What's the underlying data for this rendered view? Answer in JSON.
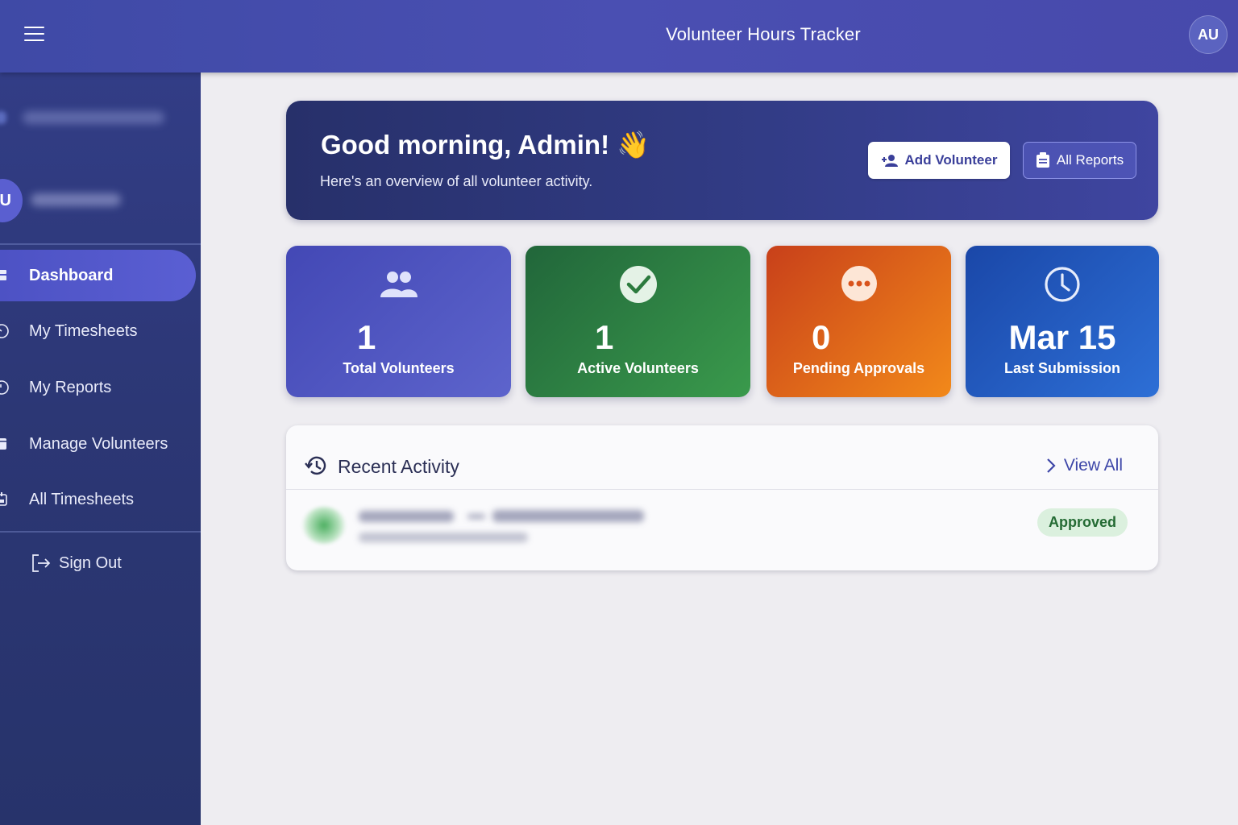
{
  "app": {
    "title": "Volunteer Hours Tracker",
    "user_initials": "AU"
  },
  "sidebar": {
    "user_initial": "U",
    "items": [
      {
        "label": "Dashboard",
        "icon": "dashboard-icon",
        "active": true
      },
      {
        "label": "My Timesheets",
        "icon": "clock-icon",
        "active": false
      },
      {
        "label": "My Reports",
        "icon": "report-icon",
        "active": false
      },
      {
        "label": "Manage Volunteers",
        "icon": "people-icon",
        "active": false
      },
      {
        "label": "All Timesheets",
        "icon": "calendar-icon",
        "active": false
      }
    ],
    "sign_out": "Sign Out"
  },
  "hero": {
    "greeting": "Good morning, Admin! 👋",
    "subtitle": "Here's an overview of all volunteer activity.",
    "add_button": "Add Volunteer",
    "reports_button": "All Reports"
  },
  "stats": [
    {
      "value": "1",
      "label": "Total Volunteers",
      "icon": "people-icon",
      "color": "#4a50bd"
    },
    {
      "value": "1",
      "label": "Active Volunteers",
      "icon": "check-circle-icon",
      "color": "#2e8142"
    },
    {
      "value": "0",
      "label": "Pending Approvals",
      "icon": "more-dots-icon",
      "color": "#e06a1a"
    },
    {
      "value": "Mar 15",
      "label": "Last Submission",
      "icon": "clock-icon",
      "color": "#2259c2"
    }
  ],
  "activity": {
    "title": "Recent Activity",
    "view_all": "View All",
    "items": [
      {
        "status": "Approved",
        "status_color": "#246b34"
      }
    ]
  }
}
